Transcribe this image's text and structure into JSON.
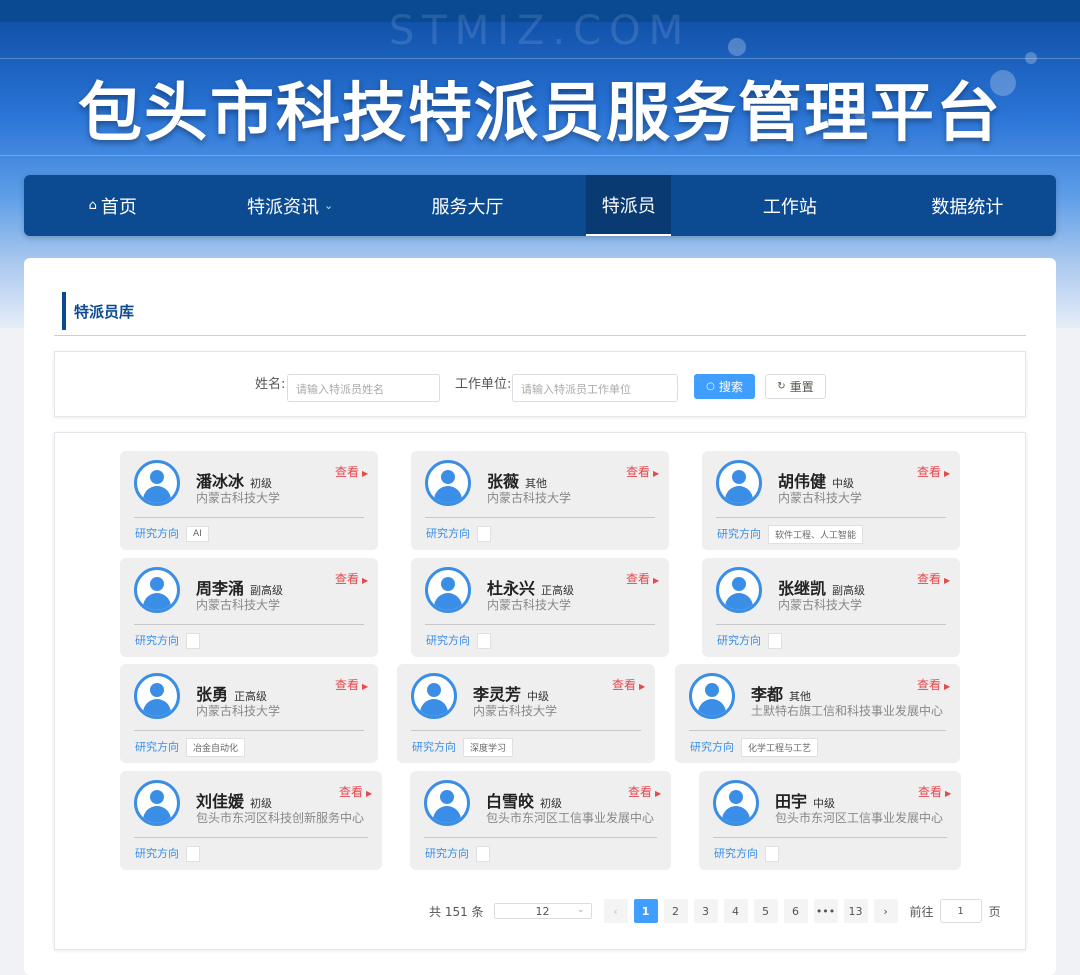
{
  "site_title": "包头市科技特派员服务管理平台",
  "watermark": "STMIZ.COM",
  "nav": {
    "home": "首页",
    "news": "特派资讯",
    "hall": "服务大厅",
    "commissioner": "特派员",
    "station": "工作站",
    "stats": "数据统计"
  },
  "section_title": "特派员库",
  "search": {
    "name_label": "姓名:",
    "name_placeholder": "请输入特派员姓名",
    "org_label": "工作单位:",
    "org_placeholder": "请输入特派员工作单位",
    "search_btn": "搜索",
    "reset_btn": "重置"
  },
  "card_labels": {
    "view": "查看",
    "direction": "研究方向"
  },
  "cards": [
    {
      "name": "潘冰冰",
      "level": "初级",
      "org": "内蒙古科技大学",
      "tag": "AI"
    },
    {
      "name": "张薇",
      "level": "其他",
      "org": "内蒙古科技大学",
      "tag": ""
    },
    {
      "name": "胡伟健",
      "level": "中级",
      "org": "内蒙古科技大学",
      "tag": "软件工程、人工智能"
    },
    {
      "name": "周李涌",
      "level": "副高级",
      "org": "内蒙古科技大学",
      "tag": ""
    },
    {
      "name": "杜永兴",
      "level": "正高级",
      "org": "内蒙古科技大学",
      "tag": ""
    },
    {
      "name": "张继凯",
      "level": "副高级",
      "org": "内蒙古科技大学",
      "tag": ""
    },
    {
      "name": "张勇",
      "level": "正高级",
      "org": "内蒙古科技大学",
      "tag": "冶金自动化"
    },
    {
      "name": "李灵芳",
      "level": "中级",
      "org": "内蒙古科技大学",
      "tag": "深度学习"
    },
    {
      "name": "李都",
      "level": "其他",
      "org": "土默特右旗工信和科技事业发展中心",
      "tag": "化学工程与工艺"
    },
    {
      "name": "刘佳媛",
      "level": "初级",
      "org": "包头市东河区科技创新服务中心",
      "tag": ""
    },
    {
      "name": "白雪皎",
      "level": "初级",
      "org": "包头市东河区工信事业发展中心",
      "tag": ""
    },
    {
      "name": "田宇",
      "level": "中级",
      "org": "包头市东河区工信事业发展中心",
      "tag": ""
    }
  ],
  "pagination": {
    "total": "共 151 条",
    "page_size": "12",
    "pages": [
      "1",
      "2",
      "3",
      "4",
      "5",
      "6",
      "•••",
      "13"
    ],
    "current": "1",
    "goto_label": "前往",
    "goto_value": "1",
    "page_unit": "页",
    "prev": "‹",
    "next": "›"
  },
  "colors": {
    "nav_bg": "#0c4b91",
    "accent": "#409eff",
    "view_red": "#e5484d",
    "avatar_blue": "#3a8ee6"
  }
}
